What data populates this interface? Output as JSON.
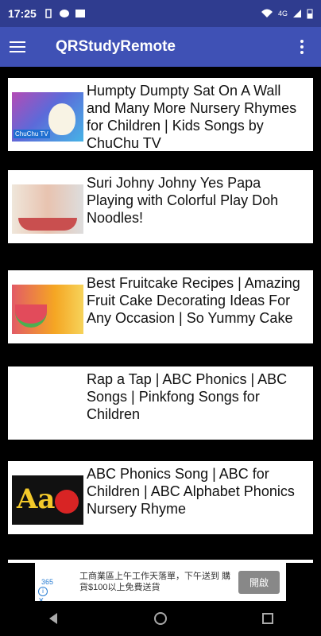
{
  "status_bar": {
    "time": "17:25",
    "network": "4G"
  },
  "app_bar": {
    "title": "QRStudyRemote"
  },
  "videos": [
    {
      "title": "Humpty Dumpty Sat On A Wall and Many More Nursery Rhymes for Children | Kids Songs by ChuChu TV",
      "thumb_caption": "ChuChu TV"
    },
    {
      "title": "Suri Johny Johny Yes Papa Playing with Colorful Play Doh Noodles!"
    },
    {
      "title": "Best Fruitcake Recipes | Amazing Fruit Cake Decorating Ideas For Any Occasion | So Yummy Cake"
    },
    {
      "title": "Rap a Tap | ABC Phonics | ABC Songs | Pinkfong Songs for Children"
    },
    {
      "title": "ABC Phonics Song | ABC for Children | ABC Alphabet Phonics Nursery Rhyme",
      "thumb_caption": "Aa"
    }
  ],
  "ad": {
    "logo_text": "365",
    "text": "工商業區上午工作天落單，下午送到 購貨$100以上免費送貨",
    "button": "開啟"
  },
  "icons": {
    "menu": "hamburger-menu-icon",
    "overflow": "more-vert-icon",
    "back": "back-triangle-icon",
    "home": "home-circle-icon",
    "recents": "recents-square-icon"
  },
  "colors": {
    "status_bar": "#2f3c8f",
    "app_bar": "#3f51b5",
    "background": "#000000"
  }
}
